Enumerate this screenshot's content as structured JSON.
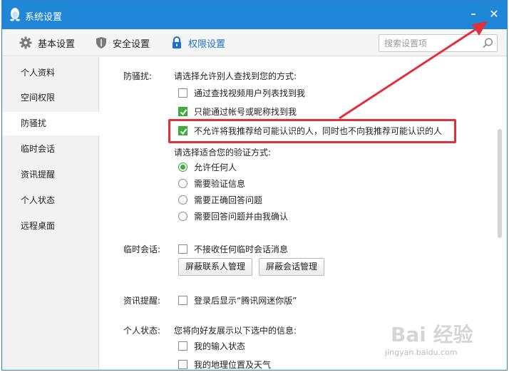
{
  "window": {
    "title": "系统设置",
    "minimize_label": "–",
    "close_label": "✕"
  },
  "toolbar": {
    "tabs": [
      {
        "label": "基本设置",
        "icon": "gear-icon"
      },
      {
        "label": "安全设置",
        "icon": "shield-icon"
      },
      {
        "label": "权限设置",
        "icon": "lock-icon"
      }
    ],
    "active_tab": "权限设置",
    "search_placeholder": "搜索设置项"
  },
  "sidebar": {
    "items": [
      {
        "label": "个人资料"
      },
      {
        "label": "空间权限"
      },
      {
        "label": "防骚扰"
      },
      {
        "label": "临时会话"
      },
      {
        "label": "资讯提醒"
      },
      {
        "label": "个人状态"
      },
      {
        "label": "远程桌面"
      }
    ],
    "active_item": "防骚扰"
  },
  "anti_harass": {
    "label": "防骚扰:",
    "find_prompt": "请选择允许别人查找到您的方式:",
    "find_options": [
      {
        "label": "通过查找视频用户列表找到我",
        "checked": false
      },
      {
        "label": "只能通过帐号或昵称找到我",
        "checked": true
      },
      {
        "label": "不允许将我推荐给可能认识的人，同时也不向我推荐可能认识的人",
        "checked": true
      }
    ],
    "verify_prompt": "请选择适合您的验证方式:",
    "verify_options": [
      {
        "label": "允许任何人",
        "selected": true
      },
      {
        "label": "需要验证信息",
        "selected": false
      },
      {
        "label": "需要正确回答问题",
        "selected": false
      },
      {
        "label": "需要回答问题并由我确认",
        "selected": false
      }
    ]
  },
  "temp_session": {
    "label": "临时会话:",
    "option": {
      "label": "不接收任何临时会话消息",
      "checked": false
    },
    "buttons": [
      "屏蔽联系人管理",
      "屏蔽会话管理"
    ]
  },
  "news_reminder": {
    "label": "资讯提醒:",
    "option": {
      "label": "登录后显示“腾讯网迷你版”",
      "checked": false
    }
  },
  "personal_status": {
    "label": "个人状态:",
    "prompt": "您将向好友展示以下选中的信息:",
    "options": [
      {
        "label": "我的输入状态",
        "checked": false
      },
      {
        "label": "我的地理位置及天气",
        "checked": false
      }
    ]
  },
  "watermark": {
    "main": "Bai 经验",
    "sub": "jingyan.baidu.com"
  },
  "colors": {
    "titlebar": "#1f86d8",
    "accent": "#1d70c9",
    "check": "#3fae3f",
    "highlight": "#e1303b"
  }
}
